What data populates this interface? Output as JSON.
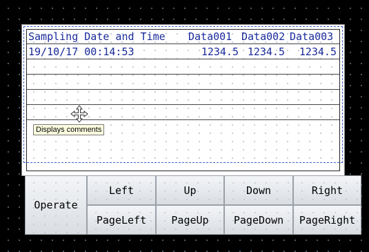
{
  "table": {
    "headers": [
      "Sampling Date and Time",
      "Data001",
      "Data002",
      "Data003"
    ],
    "rows": [
      [
        "19/10/17 00:14:53",
        "1234.5",
        "1234.5",
        "1234.5"
      ]
    ]
  },
  "tooltip": "Displays comments",
  "cursor_icon": "move-icon",
  "buttons": {
    "operate": "Operate",
    "left": "Left",
    "up": "Up",
    "down": "Down",
    "right": "Right",
    "page_left": "PageLeft",
    "page_up": "PageUp",
    "page_down": "PageDown",
    "page_right": "PageRight"
  }
}
